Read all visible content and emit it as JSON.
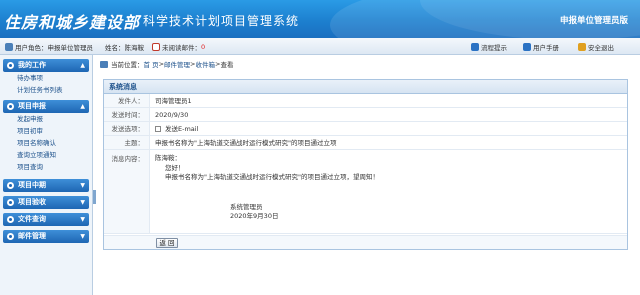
{
  "header": {
    "logo": "住房和城乡建设部",
    "system_title": "科学技术计划项目管理系统",
    "edition": "申报单位管理员版"
  },
  "infobar": {
    "role_label": "用户角色：申报单位管理员",
    "name_label": "姓名：陈海鞍",
    "unread_label": "未阅读邮件：",
    "unread_count": "0",
    "links": [
      "流程提示",
      "用户手册",
      "安全退出"
    ]
  },
  "sidebar": {
    "groups": [
      {
        "title": "我的工作",
        "items": [
          "待办事项",
          "计划任务书列表"
        ]
      },
      {
        "title": "项目申报",
        "items": [
          "发起申报",
          "项目初审",
          "项目名称确认",
          "查询立项通知",
          "项目查询"
        ]
      },
      {
        "title": "项目中期",
        "items": []
      },
      {
        "title": "项目验收",
        "items": []
      },
      {
        "title": "文件查询",
        "items": []
      },
      {
        "title": "邮件管理",
        "items": []
      }
    ]
  },
  "breadcrumb": {
    "prefix": "当前位置：",
    "items": [
      "首 页",
      "邮件管理",
      "收件箱",
      "查看"
    ],
    "separator": " > "
  },
  "message": {
    "panel_title": "系统消息",
    "sender_label": "发件人：",
    "sender": "司海管理员1",
    "time_label": "发送时间：",
    "time": "2020/9/30",
    "option_label": "发送选项：",
    "option": "发送E-mail",
    "subject_label": "主题：",
    "subject": "申报书名称为\"上海轨道交通战时运行模式研究\"的项目通过立项",
    "content_label": "消息内容：",
    "content_to": "陈海鞍：",
    "content_greeting": "您好！",
    "content_body": "申报书名称为\"上海轨道交通战时运行模式研究\"的项目通过立项，望周知！",
    "content_sign_name": "系统管理员",
    "content_sign_date": "2020年9月30日",
    "back_button": "返 回"
  }
}
